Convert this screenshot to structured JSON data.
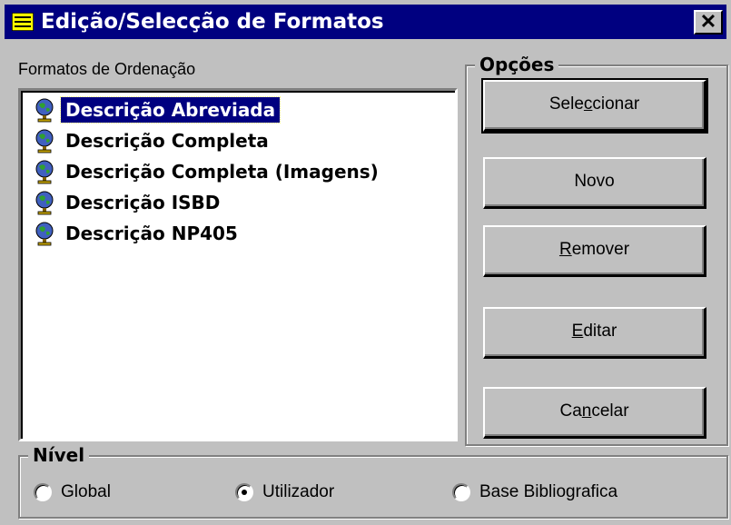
{
  "window": {
    "title": "Edição/Selecção de Formatos",
    "close_label": "✕"
  },
  "formats": {
    "label": "Formatos de Ordenação",
    "items": [
      {
        "label": "Descrição Abreviada",
        "selected": true
      },
      {
        "label": "Descrição Completa",
        "selected": false
      },
      {
        "label": "Descrição Completa (Imagens)",
        "selected": false
      },
      {
        "label": "Descrição ISBD",
        "selected": false
      },
      {
        "label": "Descrição NP405",
        "selected": false
      }
    ]
  },
  "options": {
    "legend": "Opções",
    "buttons": [
      {
        "pre": "Sele",
        "accel": "c",
        "post": "cionar"
      },
      {
        "pre": "Novo",
        "accel": "",
        "post": ""
      },
      {
        "pre": "",
        "accel": "R",
        "post": "emover"
      },
      {
        "pre": "",
        "accel": "E",
        "post": "ditar"
      },
      {
        "pre": "Ca",
        "accel": "n",
        "post": "celar"
      }
    ]
  },
  "level": {
    "legend": "Nível",
    "options": [
      {
        "label": "Global",
        "checked": false
      },
      {
        "label": "Utilizador",
        "checked": true
      },
      {
        "label": "Base Bibliografica",
        "checked": false
      }
    ]
  },
  "colors": {
    "title_bg": "#000080",
    "face": "#c0c0c0",
    "selection": "#000080"
  }
}
